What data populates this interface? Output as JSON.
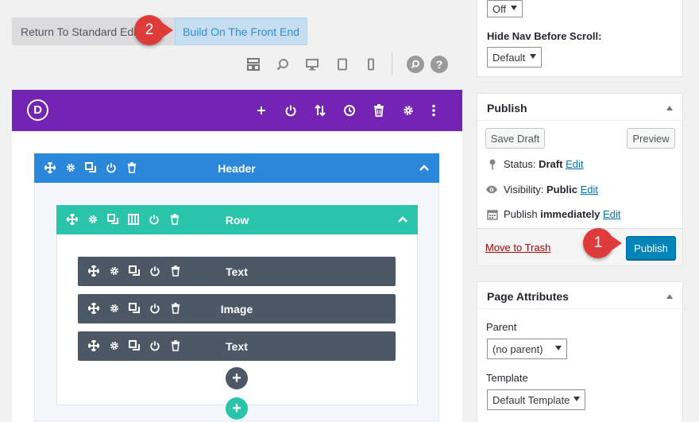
{
  "top": {
    "return_label": "Return To Standard Editor",
    "build_label": "Build On The Front End",
    "marker_build": "2"
  },
  "builder": {
    "logo_letter": "D",
    "section_title": "Header",
    "row_title": "Row",
    "modules": [
      "Text",
      "Image",
      "Text"
    ],
    "add_module": "+",
    "add_row": "+"
  },
  "sidebar": {
    "nav_select_value": "Off",
    "hide_nav_label": "Hide Nav Before Scroll:",
    "hide_nav_value": "Default",
    "publish": {
      "title": "Publish",
      "save_draft": "Save Draft",
      "preview": "Preview",
      "status_label": "Status:",
      "status_value": "Draft",
      "status_edit": "Edit",
      "visibility_label": "Visibility:",
      "visibility_value": "Public",
      "visibility_edit": "Edit",
      "publish_label": "Publish",
      "publish_when": "immediately",
      "publish_edit": "Edit",
      "trash": "Move to Trash",
      "publish_button": "Publish",
      "marker": "1"
    },
    "page_attributes": {
      "title": "Page Attributes",
      "parent_label": "Parent",
      "parent_value": "(no parent)",
      "template_label": "Template",
      "template_value": "Default Template"
    }
  },
  "colors": {
    "builder_purple": "#7424b2",
    "section_blue": "#2b87da",
    "row_green": "#29c4a9",
    "module_gray": "#4c5866",
    "marker_red": "#e03b3b",
    "publish_blue": "#0085ba"
  }
}
